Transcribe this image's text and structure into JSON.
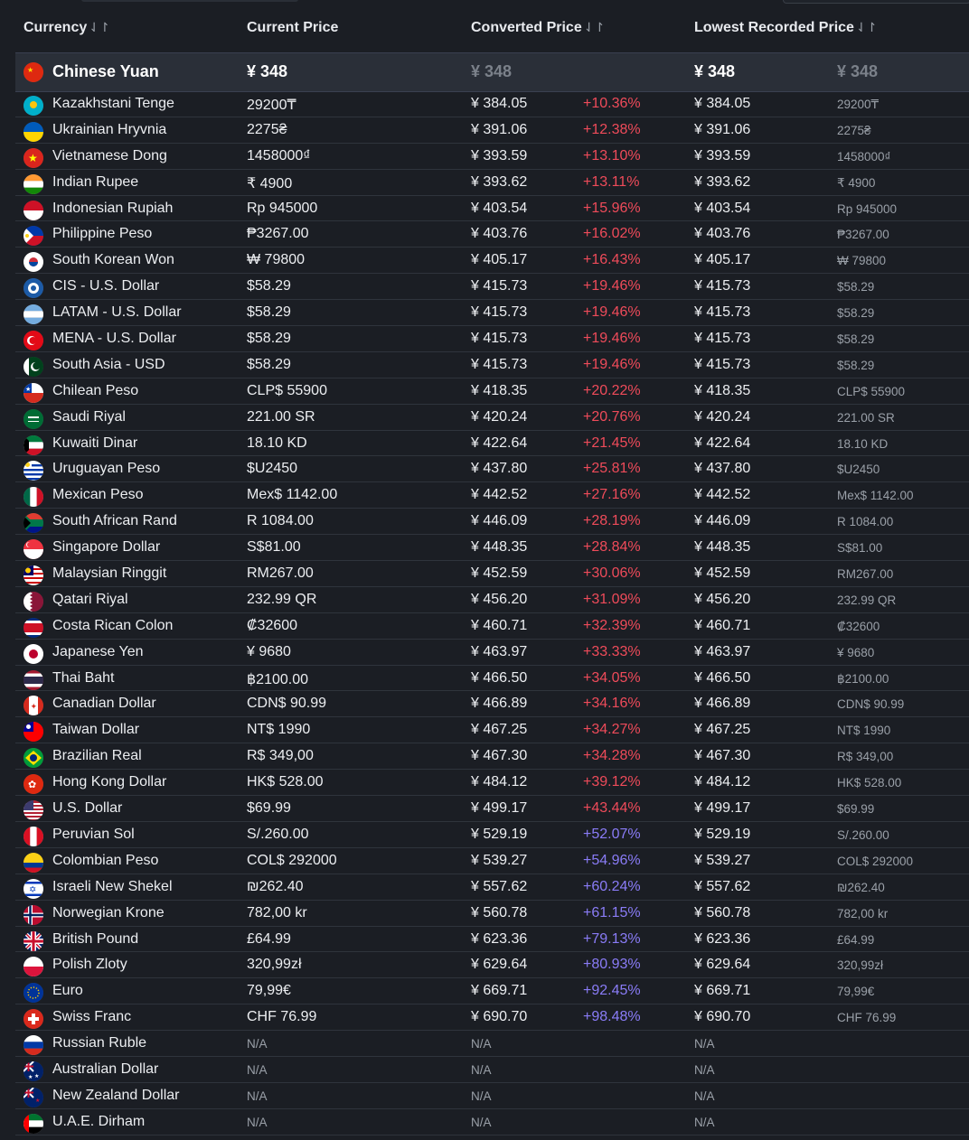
{
  "header": {
    "currency": "Currency",
    "current_price": "Current Price",
    "converted_price": "Converted Price",
    "lowest_recorded_price": "Lowest Recorded Price",
    "sort_icon": "⇃↾"
  },
  "highlight": {
    "name": "Chinese Yuan",
    "current": "¥ 348",
    "converted": "¥ 348",
    "lowest": "¥ 348",
    "lowest_orig": "¥ 348",
    "flag": "cn"
  },
  "rows": [
    {
      "flag": "kz",
      "name": "Kazakhstani Tenge",
      "current": "29200₸",
      "converted": "¥ 384.05",
      "pct": "+10.36%",
      "lowest": "¥ 384.05",
      "orig": "29200₸"
    },
    {
      "flag": "ua",
      "name": "Ukrainian Hryvnia",
      "current": "2275₴",
      "converted": "¥ 391.06",
      "pct": "+12.38%",
      "lowest": "¥ 391.06",
      "orig": "2275₴"
    },
    {
      "flag": "vn",
      "name": "Vietnamese Dong",
      "current": "1458000₫",
      "converted": "¥ 393.59",
      "pct": "+13.10%",
      "lowest": "¥ 393.59",
      "orig": "1458000₫"
    },
    {
      "flag": "in",
      "name": "Indian Rupee",
      "current": "₹ 4900",
      "converted": "¥ 393.62",
      "pct": "+13.11%",
      "lowest": "¥ 393.62",
      "orig": "₹ 4900"
    },
    {
      "flag": "id",
      "name": "Indonesian Rupiah",
      "current": "Rp 945000",
      "converted": "¥ 403.54",
      "pct": "+15.96%",
      "lowest": "¥ 403.54",
      "orig": "Rp 945000"
    },
    {
      "flag": "ph",
      "name": "Philippine Peso",
      "current": "₱3267.00",
      "converted": "¥ 403.76",
      "pct": "+16.02%",
      "lowest": "¥ 403.76",
      "orig": "₱3267.00"
    },
    {
      "flag": "kr",
      "name": "South Korean Won",
      "current": "₩ 79800",
      "converted": "¥ 405.17",
      "pct": "+16.43%",
      "lowest": "¥ 405.17",
      "orig": "₩ 79800"
    },
    {
      "flag": "cis",
      "name": "CIS - U.S. Dollar",
      "current": "$58.29",
      "converted": "¥ 415.73",
      "pct": "+19.46%",
      "lowest": "¥ 415.73",
      "orig": "$58.29"
    },
    {
      "flag": "ar",
      "name": "LATAM - U.S. Dollar",
      "current": "$58.29",
      "converted": "¥ 415.73",
      "pct": "+19.46%",
      "lowest": "¥ 415.73",
      "orig": "$58.29"
    },
    {
      "flag": "tr",
      "name": "MENA - U.S. Dollar",
      "current": "$58.29",
      "converted": "¥ 415.73",
      "pct": "+19.46%",
      "lowest": "¥ 415.73",
      "orig": "$58.29"
    },
    {
      "flag": "pk",
      "name": "South Asia - USD",
      "current": "$58.29",
      "converted": "¥ 415.73",
      "pct": "+19.46%",
      "lowest": "¥ 415.73",
      "orig": "$58.29"
    },
    {
      "flag": "cl",
      "name": "Chilean Peso",
      "current": "CLP$ 55900",
      "converted": "¥ 418.35",
      "pct": "+20.22%",
      "lowest": "¥ 418.35",
      "orig": "CLP$ 55900"
    },
    {
      "flag": "sa",
      "name": "Saudi Riyal",
      "current": "221.00 SR",
      "converted": "¥ 420.24",
      "pct": "+20.76%",
      "lowest": "¥ 420.24",
      "orig": "221.00 SR"
    },
    {
      "flag": "kw",
      "name": "Kuwaiti Dinar",
      "current": "18.10 KD",
      "converted": "¥ 422.64",
      "pct": "+21.45%",
      "lowest": "¥ 422.64",
      "orig": "18.10 KD"
    },
    {
      "flag": "uy",
      "name": "Uruguayan Peso",
      "current": "$U2450",
      "converted": "¥ 437.80",
      "pct": "+25.81%",
      "lowest": "¥ 437.80",
      "orig": "$U2450"
    },
    {
      "flag": "mx",
      "name": "Mexican Peso",
      "current": "Mex$ 1142.00",
      "converted": "¥ 442.52",
      "pct": "+27.16%",
      "lowest": "¥ 442.52",
      "orig": "Mex$ 1142.00"
    },
    {
      "flag": "za",
      "name": "South African Rand",
      "current": "R 1084.00",
      "converted": "¥ 446.09",
      "pct": "+28.19%",
      "lowest": "¥ 446.09",
      "orig": "R 1084.00"
    },
    {
      "flag": "sg",
      "name": "Singapore Dollar",
      "current": "S$81.00",
      "converted": "¥ 448.35",
      "pct": "+28.84%",
      "lowest": "¥ 448.35",
      "orig": "S$81.00"
    },
    {
      "flag": "my",
      "name": "Malaysian Ringgit",
      "current": "RM267.00",
      "converted": "¥ 452.59",
      "pct": "+30.06%",
      "lowest": "¥ 452.59",
      "orig": "RM267.00"
    },
    {
      "flag": "qa",
      "name": "Qatari Riyal",
      "current": "232.99 QR",
      "converted": "¥ 456.20",
      "pct": "+31.09%",
      "lowest": "¥ 456.20",
      "orig": "232.99 QR"
    },
    {
      "flag": "cr",
      "name": "Costa Rican Colon",
      "current": "₡32600",
      "converted": "¥ 460.71",
      "pct": "+32.39%",
      "lowest": "¥ 460.71",
      "orig": "₡32600"
    },
    {
      "flag": "jp",
      "name": "Japanese Yen",
      "current": "¥ 9680",
      "converted": "¥ 463.97",
      "pct": "+33.33%",
      "lowest": "¥ 463.97",
      "orig": "¥ 9680"
    },
    {
      "flag": "th",
      "name": "Thai Baht",
      "current": "฿2100.00",
      "converted": "¥ 466.50",
      "pct": "+34.05%",
      "lowest": "¥ 466.50",
      "orig": "฿2100.00"
    },
    {
      "flag": "ca",
      "name": "Canadian Dollar",
      "current": "CDN$ 90.99",
      "converted": "¥ 466.89",
      "pct": "+34.16%",
      "lowest": "¥ 466.89",
      "orig": "CDN$ 90.99"
    },
    {
      "flag": "tw",
      "name": "Taiwan Dollar",
      "current": "NT$ 1990",
      "converted": "¥ 467.25",
      "pct": "+34.27%",
      "lowest": "¥ 467.25",
      "orig": "NT$ 1990"
    },
    {
      "flag": "br",
      "name": "Brazilian Real",
      "current": "R$ 349,00",
      "converted": "¥ 467.30",
      "pct": "+34.28%",
      "lowest": "¥ 467.30",
      "orig": "R$ 349,00"
    },
    {
      "flag": "hk",
      "name": "Hong Kong Dollar",
      "current": "HK$ 528.00",
      "converted": "¥ 484.12",
      "pct": "+39.12%",
      "lowest": "¥ 484.12",
      "orig": "HK$ 528.00"
    },
    {
      "flag": "us",
      "name": "U.S. Dollar",
      "current": "$69.99",
      "converted": "¥ 499.17",
      "pct": "+43.44%",
      "lowest": "¥ 499.17",
      "orig": "$69.99"
    },
    {
      "flag": "pe",
      "name": "Peruvian Sol",
      "current": "S/.260.00",
      "converted": "¥ 529.19",
      "pct": "+52.07%",
      "lowest": "¥ 529.19",
      "orig": "S/.260.00"
    },
    {
      "flag": "co",
      "name": "Colombian Peso",
      "current": "COL$ 292000",
      "converted": "¥ 539.27",
      "pct": "+54.96%",
      "lowest": "¥ 539.27",
      "orig": "COL$ 292000"
    },
    {
      "flag": "il",
      "name": "Israeli New Shekel",
      "current": "₪262.40",
      "converted": "¥ 557.62",
      "pct": "+60.24%",
      "lowest": "¥ 557.62",
      "orig": "₪262.40"
    },
    {
      "flag": "no",
      "name": "Norwegian Krone",
      "current": "782,00 kr",
      "converted": "¥ 560.78",
      "pct": "+61.15%",
      "lowest": "¥ 560.78",
      "orig": "782,00 kr"
    },
    {
      "flag": "gb",
      "name": "British Pound",
      "current": "£64.99",
      "converted": "¥ 623.36",
      "pct": "+79.13%",
      "lowest": "¥ 623.36",
      "orig": "£64.99"
    },
    {
      "flag": "pl",
      "name": "Polish Zloty",
      "current": "320,99zł",
      "converted": "¥ 629.64",
      "pct": "+80.93%",
      "lowest": "¥ 629.64",
      "orig": "320,99zł"
    },
    {
      "flag": "eu",
      "name": "Euro",
      "current": "79,99€",
      "converted": "¥ 669.71",
      "pct": "+92.45%",
      "lowest": "¥ 669.71",
      "orig": "79,99€"
    },
    {
      "flag": "ch",
      "name": "Swiss Franc",
      "current": "CHF 76.99",
      "converted": "¥ 690.70",
      "pct": "+98.48%",
      "lowest": "¥ 690.70",
      "orig": "CHF 76.99"
    },
    {
      "flag": "ru",
      "name": "Russian Ruble",
      "current": "N/A",
      "converted": "N/A",
      "pct": "",
      "lowest": "N/A",
      "orig": ""
    },
    {
      "flag": "au",
      "name": "Australian Dollar",
      "current": "N/A",
      "converted": "N/A",
      "pct": "",
      "lowest": "N/A",
      "orig": ""
    },
    {
      "flag": "nz",
      "name": "New Zealand Dollar",
      "current": "N/A",
      "converted": "N/A",
      "pct": "",
      "lowest": "N/A",
      "orig": ""
    },
    {
      "flag": "ae",
      "name": "U.A.E. Dirham",
      "current": "N/A",
      "converted": "N/A",
      "pct": "",
      "lowest": "N/A",
      "orig": ""
    }
  ],
  "colors": {
    "background": "#1b1e24",
    "increase_low": "#ef4b5a",
    "increase_high": "#8a7cf7",
    "muted": "#9aa0a8"
  }
}
